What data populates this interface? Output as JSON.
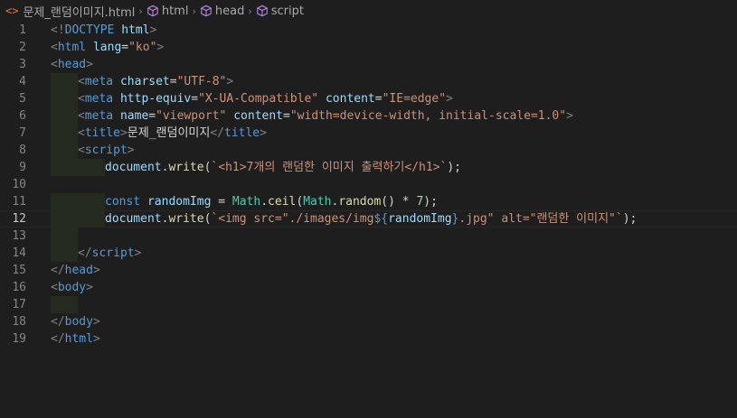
{
  "breadcrumb": {
    "file_icon": "<>",
    "file": "문제_랜덤이미지.html",
    "parts": [
      "html",
      "head",
      "script"
    ],
    "separator": "›"
  },
  "editor": {
    "current_line": 12,
    "lines": [
      {
        "n": "1",
        "tokens": [
          [
            "punc",
            "<!"
          ],
          [
            "tag",
            "DOCTYPE"
          ],
          [
            "text",
            " "
          ],
          [
            "attr",
            "html"
          ],
          [
            "punc",
            ">"
          ]
        ]
      },
      {
        "n": "2",
        "tokens": [
          [
            "punc",
            "<"
          ],
          [
            "tag",
            "html"
          ],
          [
            "text",
            " "
          ],
          [
            "attr",
            "lang"
          ],
          [
            "text",
            "="
          ],
          [
            "str",
            "\"ko\""
          ],
          [
            "punc",
            ">"
          ]
        ]
      },
      {
        "n": "3",
        "tokens": [
          [
            "punc",
            "<"
          ],
          [
            "tag",
            "head"
          ],
          [
            "punc",
            ">"
          ]
        ]
      },
      {
        "n": "4",
        "indent": 1,
        "tokens": [
          [
            "punc",
            "<"
          ],
          [
            "tag",
            "meta"
          ],
          [
            "text",
            " "
          ],
          [
            "attr",
            "charset"
          ],
          [
            "text",
            "="
          ],
          [
            "str",
            "\"UTF-8\""
          ],
          [
            "punc",
            ">"
          ]
        ]
      },
      {
        "n": "5",
        "indent": 1,
        "tokens": [
          [
            "punc",
            "<"
          ],
          [
            "tag",
            "meta"
          ],
          [
            "text",
            " "
          ],
          [
            "attr",
            "http-equiv"
          ],
          [
            "text",
            "="
          ],
          [
            "str",
            "\"X-UA-Compatible\""
          ],
          [
            "text",
            " "
          ],
          [
            "attr",
            "content"
          ],
          [
            "text",
            "="
          ],
          [
            "str",
            "\"IE=edge\""
          ],
          [
            "punc",
            ">"
          ]
        ]
      },
      {
        "n": "6",
        "indent": 1,
        "tokens": [
          [
            "punc",
            "<"
          ],
          [
            "tag",
            "meta"
          ],
          [
            "text",
            " "
          ],
          [
            "attr",
            "name"
          ],
          [
            "text",
            "="
          ],
          [
            "str",
            "\"viewport\""
          ],
          [
            "text",
            " "
          ],
          [
            "attr",
            "content"
          ],
          [
            "text",
            "="
          ],
          [
            "str",
            "\"width=device-width, initial-scale=1.0\""
          ],
          [
            "punc",
            ">"
          ]
        ]
      },
      {
        "n": "7",
        "indent": 1,
        "tokens": [
          [
            "punc",
            "<"
          ],
          [
            "tag",
            "title"
          ],
          [
            "punc",
            ">"
          ],
          [
            "text",
            "문제_랜덤이미지"
          ],
          [
            "punc",
            "</"
          ],
          [
            "tag",
            "title"
          ],
          [
            "punc",
            ">"
          ]
        ]
      },
      {
        "n": "8",
        "indent": 1,
        "tokens": [
          [
            "punc",
            "<"
          ],
          [
            "tag",
            "script"
          ],
          [
            "punc",
            ">"
          ]
        ]
      },
      {
        "n": "9",
        "indent": 2,
        "tokens": [
          [
            "var",
            "document"
          ],
          [
            "text",
            "."
          ],
          [
            "fn",
            "write"
          ],
          [
            "text",
            "("
          ],
          [
            "str",
            "`<h1>7개의 랜덤한 이미지 출력하기</h1>`"
          ],
          [
            "text",
            ");"
          ]
        ]
      },
      {
        "n": "10",
        "tokens": []
      },
      {
        "n": "11",
        "indent": 2,
        "tokens": [
          [
            "kw",
            "const"
          ],
          [
            "text",
            " "
          ],
          [
            "var",
            "randomImg"
          ],
          [
            "text",
            " = "
          ],
          [
            "cls",
            "Math"
          ],
          [
            "text",
            "."
          ],
          [
            "fn",
            "ceil"
          ],
          [
            "text",
            "("
          ],
          [
            "cls",
            "Math"
          ],
          [
            "text",
            "."
          ],
          [
            "fn",
            "random"
          ],
          [
            "text",
            "() * "
          ],
          [
            "num",
            "7"
          ],
          [
            "text",
            ");"
          ]
        ]
      },
      {
        "n": "12",
        "indent": 2,
        "tokens": [
          [
            "var",
            "document"
          ],
          [
            "text",
            "."
          ],
          [
            "fn",
            "write"
          ],
          [
            "text",
            "("
          ],
          [
            "str",
            "`<img src=\"./images/img"
          ],
          [
            "interp",
            "${"
          ],
          [
            "var",
            "randomImg"
          ],
          [
            "interp",
            "}"
          ],
          [
            "str",
            ".jpg\" alt=\"랜덤한 이미지\"`"
          ],
          [
            "text",
            ");"
          ]
        ]
      },
      {
        "n": "13",
        "indent": 1,
        "tokens": []
      },
      {
        "n": "14",
        "indent": 1,
        "tokens": [
          [
            "punc",
            "</"
          ],
          [
            "tag",
            "script"
          ],
          [
            "punc",
            ">"
          ]
        ]
      },
      {
        "n": "15",
        "tokens": [
          [
            "punc",
            "</"
          ],
          [
            "tag",
            "head"
          ],
          [
            "punc",
            ">"
          ]
        ]
      },
      {
        "n": "16",
        "tokens": [
          [
            "punc",
            "<"
          ],
          [
            "tag",
            "body"
          ],
          [
            "punc",
            ">"
          ]
        ]
      },
      {
        "n": "17",
        "indent": 1,
        "tokens": []
      },
      {
        "n": "18",
        "tokens": [
          [
            "punc",
            "</"
          ],
          [
            "tag",
            "body"
          ],
          [
            "punc",
            ">"
          ]
        ]
      },
      {
        "n": "19",
        "tokens": [
          [
            "punc",
            "</"
          ],
          [
            "tag",
            "html"
          ],
          [
            "punc",
            ">"
          ]
        ]
      }
    ]
  }
}
